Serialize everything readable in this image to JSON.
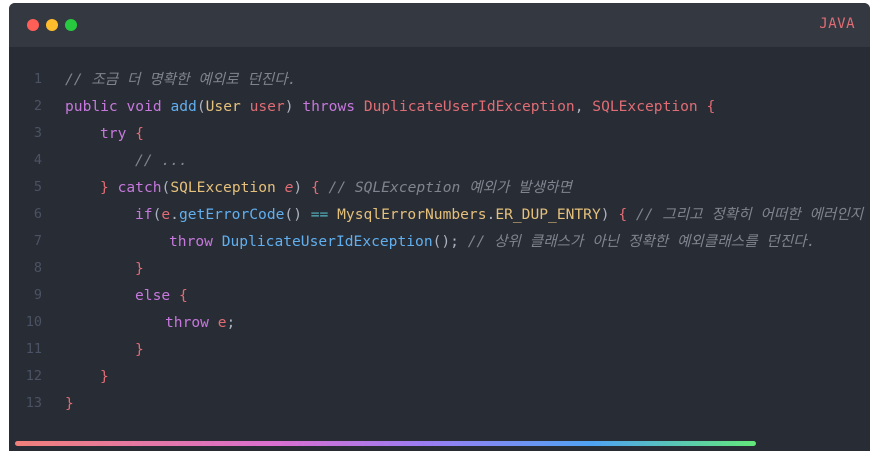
{
  "window": {
    "language": "JAVA"
  },
  "code": {
    "lines": [
      {
        "n": "1",
        "indent": 0,
        "tokens": [
          {
            "c": "cm",
            "t": "// 조금 더 명확한 예외로 던진다."
          }
        ]
      },
      {
        "n": "2",
        "indent": 0,
        "tokens": [
          {
            "c": "kw",
            "t": "public"
          },
          {
            "c": "pl",
            "t": " "
          },
          {
            "c": "kw",
            "t": "void"
          },
          {
            "c": "pl",
            "t": " "
          },
          {
            "c": "fn",
            "t": "add"
          },
          {
            "c": "pl",
            "t": "("
          },
          {
            "c": "ty",
            "t": "User"
          },
          {
            "c": "pl",
            "t": " "
          },
          {
            "c": "pa",
            "t": "user"
          },
          {
            "c": "pl",
            "t": ") "
          },
          {
            "c": "kw",
            "t": "throws"
          },
          {
            "c": "pl",
            "t": " "
          },
          {
            "c": "pa",
            "t": "DuplicateUserIdException"
          },
          {
            "c": "pl",
            "t": ", "
          },
          {
            "c": "pa",
            "t": "SQLException"
          },
          {
            "c": "pl",
            "t": " "
          },
          {
            "c": "pa",
            "t": "{"
          }
        ]
      },
      {
        "n": "3",
        "indent": 35,
        "tokens": [
          {
            "c": "kw",
            "t": "try"
          },
          {
            "c": "pl",
            "t": " "
          },
          {
            "c": "pa",
            "t": "{"
          }
        ]
      },
      {
        "n": "4",
        "indent": 70,
        "tokens": [
          {
            "c": "cm",
            "t": "// ..."
          }
        ]
      },
      {
        "n": "5",
        "indent": 35,
        "tokens": [
          {
            "c": "pa",
            "t": "}"
          },
          {
            "c": "pl",
            "t": " "
          },
          {
            "c": "kw",
            "t": "catch"
          },
          {
            "c": "pl",
            "t": "("
          },
          {
            "c": "ty",
            "t": "SQLException"
          },
          {
            "c": "pl",
            "t": " "
          },
          {
            "c": "it",
            "t": "e"
          },
          {
            "c": "pl",
            "t": ") "
          },
          {
            "c": "pa",
            "t": "{"
          },
          {
            "c": "pl",
            "t": " "
          },
          {
            "c": "cm",
            "t": "// SQLException 예외가 발생하면"
          }
        ]
      },
      {
        "n": "6",
        "indent": 70,
        "tokens": [
          {
            "c": "kw",
            "t": "if"
          },
          {
            "c": "pl",
            "t": "("
          },
          {
            "c": "pa",
            "t": "e"
          },
          {
            "c": "pl",
            "t": "."
          },
          {
            "c": "fn",
            "t": "getErrorCode"
          },
          {
            "c": "pl",
            "t": "() "
          },
          {
            "c": "op",
            "t": "=="
          },
          {
            "c": "pl",
            "t": " "
          },
          {
            "c": "ty",
            "t": "MysqlErrorNumbers"
          },
          {
            "c": "pl",
            "t": "."
          },
          {
            "c": "ty",
            "t": "ER_DUP_ENTRY"
          },
          {
            "c": "pl",
            "t": ") "
          },
          {
            "c": "pa",
            "t": "{"
          },
          {
            "c": "pl",
            "t": " "
          },
          {
            "c": "cm",
            "t": "// 그리고 정확히 어떠한 에러인지 확인한다."
          }
        ]
      },
      {
        "n": "7",
        "indent": 104,
        "tokens": [
          {
            "c": "kw",
            "t": "throw"
          },
          {
            "c": "pl",
            "t": " "
          },
          {
            "c": "fn",
            "t": "DuplicateUserIdException"
          },
          {
            "c": "pl",
            "t": "(); "
          },
          {
            "c": "cm",
            "t": "// 상위 클래스가 아닌 정확한 예외클래스를 던진다."
          }
        ]
      },
      {
        "n": "8",
        "indent": 70,
        "tokens": [
          {
            "c": "pa",
            "t": "}"
          }
        ]
      },
      {
        "n": "9",
        "indent": 70,
        "tokens": [
          {
            "c": "kw",
            "t": "else"
          },
          {
            "c": "pl",
            "t": " "
          },
          {
            "c": "pa",
            "t": "{"
          }
        ]
      },
      {
        "n": "10",
        "indent": 100,
        "tokens": [
          {
            "c": "kw",
            "t": "throw"
          },
          {
            "c": "pl",
            "t": " "
          },
          {
            "c": "pa",
            "t": "e"
          },
          {
            "c": "pl",
            "t": ";"
          }
        ]
      },
      {
        "n": "11",
        "indent": 70,
        "tokens": [
          {
            "c": "pa",
            "t": "}"
          }
        ]
      },
      {
        "n": "12",
        "indent": 35,
        "tokens": [
          {
            "c": "pa",
            "t": "}"
          }
        ]
      },
      {
        "n": "13",
        "indent": 0,
        "tokens": [
          {
            "c": "pa",
            "t": "}"
          }
        ]
      }
    ]
  },
  "colors": {
    "background": "#282c34",
    "titlebar": "#343841",
    "keyword": "#c678dd",
    "function": "#61afef",
    "type": "#e5c07b",
    "variable": "#e06c75",
    "comment": "#7f848e",
    "line_number": "#4b5263"
  },
  "icons": [
    "close-dot-icon",
    "minimize-dot-icon",
    "maximize-dot-icon"
  ]
}
